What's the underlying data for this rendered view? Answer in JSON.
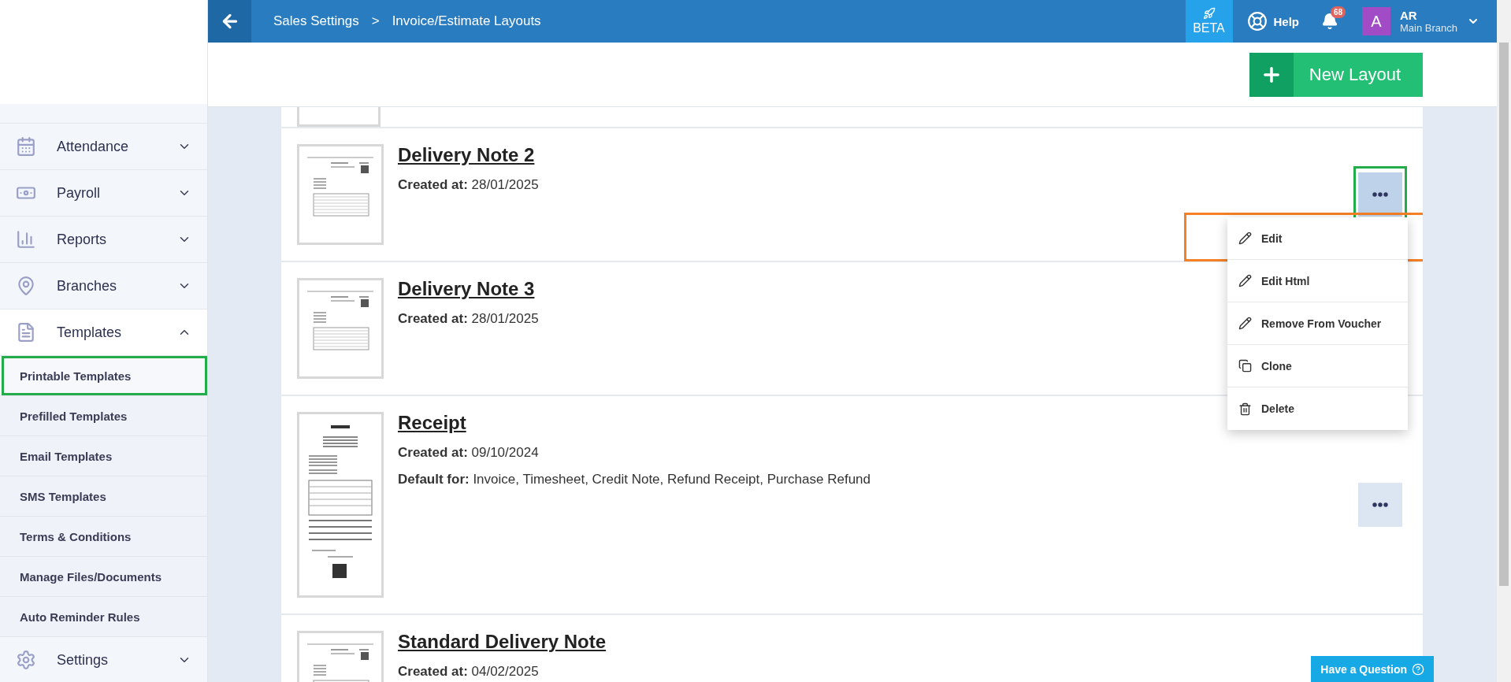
{
  "topbar": {
    "breadcrumb": [
      "Sales Settings",
      "Invoice/Estimate Layouts"
    ],
    "breadcrumb_separator": ">",
    "beta": "BETA",
    "help": "Help",
    "notifications": "68",
    "user": {
      "initial": "A",
      "name": "AR",
      "branch": "Main Branch"
    }
  },
  "sidebar": {
    "items": [
      {
        "label": "Attendance",
        "expanded": false
      },
      {
        "label": "Payroll",
        "expanded": false
      },
      {
        "label": "Reports",
        "expanded": false
      },
      {
        "label": "Branches",
        "expanded": false
      },
      {
        "label": "Templates",
        "expanded": true,
        "children": [
          {
            "label": "Printable Templates",
            "selected": true,
            "highlighted": true
          },
          {
            "label": "Prefilled Templates",
            "selected": false,
            "highlighted": false
          },
          {
            "label": "Email Templates",
            "selected": false,
            "highlighted": false
          },
          {
            "label": "SMS Templates",
            "selected": false,
            "highlighted": false
          },
          {
            "label": "Terms & Conditions",
            "selected": false,
            "highlighted": false
          },
          {
            "label": "Manage Files/Documents",
            "selected": false,
            "highlighted": false
          },
          {
            "label": "Auto Reminder Rules",
            "selected": false,
            "highlighted": false
          }
        ]
      },
      {
        "label": "Settings",
        "expanded": false
      }
    ]
  },
  "new_layout": "New Layout",
  "layouts": [
    {
      "kind": "page",
      "title": "Delivery Note 2",
      "created": "**Created at:** 28/01/2025",
      "menu_open": true,
      "highlighted": true
    },
    {
      "kind": "page",
      "title": "Delivery Note 3",
      "created": "**Created at:** 28/01/2025"
    },
    {
      "kind": "receipt",
      "title": "Receipt",
      "created": "**Created at:** 09/10/2024",
      "default_for": "**Default for:** Invoice, Timesheet, Credit Note, Refund Receipt, Purchase Refund",
      "menu_open": false,
      "highlighted": false
    },
    {
      "kind": "page",
      "title": "Standard Delivery Note",
      "created": "**Created at:** 04/02/2025"
    }
  ],
  "menu": [
    {
      "label": "Edit",
      "highlighted": true
    },
    {
      "label": "Edit Html",
      "highlighted": false
    },
    {
      "label": "Remove From Voucher",
      "highlighted": false
    },
    {
      "label": "Clone",
      "highlighted": false
    },
    {
      "label": "Delete",
      "highlighted": false
    }
  ],
  "help_button": "Have a Question"
}
